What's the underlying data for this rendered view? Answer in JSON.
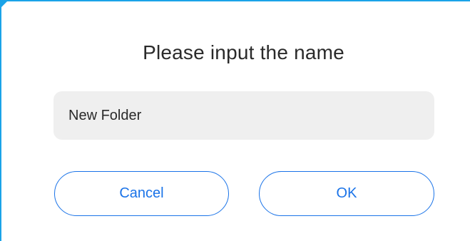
{
  "dialog": {
    "title": "Please input the name",
    "name_input": {
      "value": "New Folder",
      "placeholder": ""
    },
    "cancel_label": "Cancel",
    "ok_label": "OK"
  },
  "colors": {
    "accent": "#1a73e8",
    "frame_border": "#1aa3e8",
    "input_background": "#efefef",
    "text": "#2a2a2a"
  }
}
